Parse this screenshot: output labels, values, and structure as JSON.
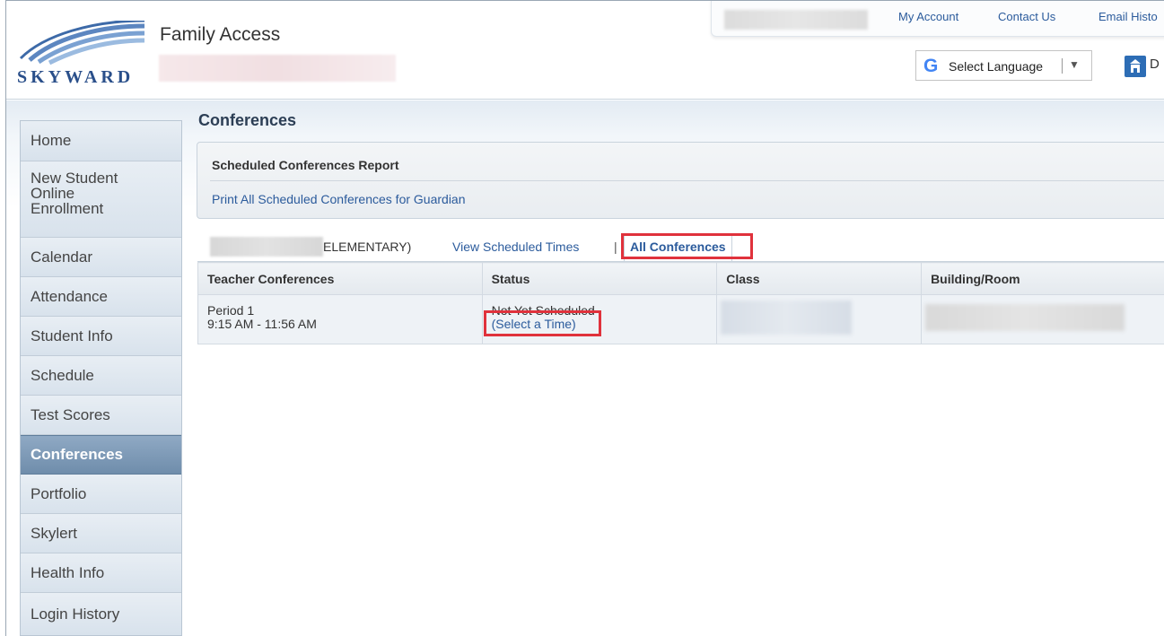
{
  "header": {
    "logo_text": "SKYWARD",
    "app_title": "Family Access",
    "top_links": [
      "My Account",
      "Contact Us",
      "Email Histo"
    ],
    "language_label": "Select Language",
    "language_arrow": "▼",
    "building_letter": "D"
  },
  "sidebar": {
    "items": [
      {
        "label": "Home"
      },
      {
        "label": "New Student Online Enrollment"
      },
      {
        "label": "Calendar"
      },
      {
        "label": "Attendance"
      },
      {
        "label": "Student Info"
      },
      {
        "label": "Schedule"
      },
      {
        "label": "Test Scores"
      },
      {
        "label": "Conferences"
      },
      {
        "label": "Portfolio"
      },
      {
        "label": "Skylert"
      },
      {
        "label": "Health Info"
      },
      {
        "label": "Login History"
      }
    ],
    "new_student_lines": [
      "New Student",
      "Online",
      "Enrollment"
    ],
    "active_item": "Conferences"
  },
  "main": {
    "page_title": "Conferences",
    "report": {
      "title": "Scheduled Conferences Report",
      "link": "Print All Scheduled Conferences for Guardian"
    },
    "tabs": {
      "school_suffix": "ELEMENTARY)",
      "view_scheduled": "View Scheduled Times",
      "separator": "|",
      "active": "All Conferences"
    },
    "table": {
      "columns": [
        "Teacher Conferences",
        "Status",
        "Class",
        "Building/Room"
      ],
      "rows": [
        {
          "period": "Period 1",
          "time": "9:15 AM - 11:56 AM",
          "status": "Not Yet Scheduled",
          "action": "(Select a Time)"
        }
      ]
    }
  },
  "colors": {
    "link": "#2b5b9c",
    "active_nav": "#7b97b5",
    "highlight": "#e0323c"
  }
}
